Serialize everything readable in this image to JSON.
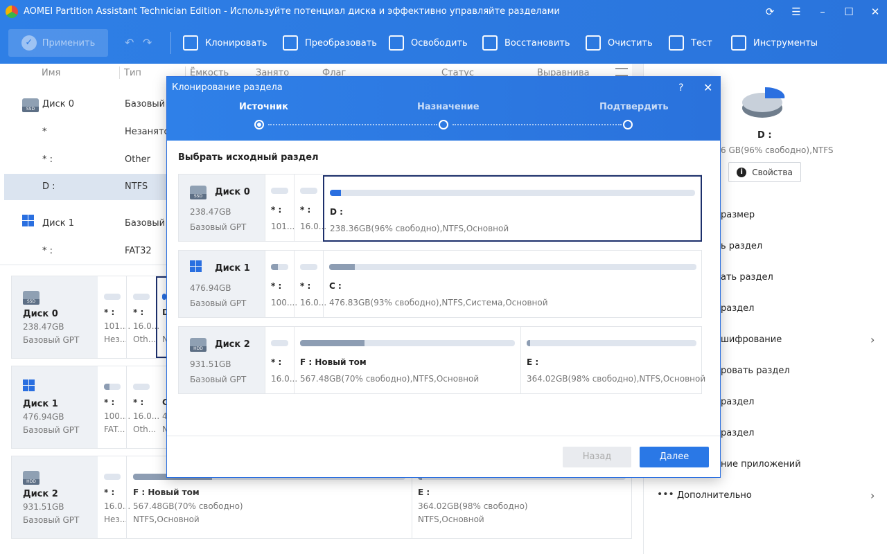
{
  "app": {
    "title": "AOMEI Partition Assistant Technician Edition - Используйте потенциал диска и эффективно управляйте разделами"
  },
  "toolbar": {
    "apply": "Применить",
    "items": [
      "Клонировать",
      "Преобразовать",
      "Освободить",
      "Восстановить",
      "Очистить",
      "Тест",
      "Инструменты"
    ]
  },
  "table": {
    "headers": [
      "Имя",
      "Тип",
      "Ёмкость",
      "Занято",
      "Флаг",
      "Статус",
      "Выравнива"
    ],
    "rows": [
      {
        "name": "Диск 0",
        "type": "Базовый G"
      },
      {
        "name": "*",
        "type": "Незанято"
      },
      {
        "name": "* :",
        "type": "Other"
      },
      {
        "name": "D :",
        "type": "NTFS"
      },
      {
        "name": "Диск 1",
        "type": "Базовый G"
      },
      {
        "name": "* :",
        "type": "FAT32"
      }
    ]
  },
  "diskmap": [
    {
      "name": "Диск 0",
      "size": "238.47GB",
      "type": "Базовый GPT",
      "parts": [
        {
          "n": "* :",
          "s": "101....",
          "f": "Нез..."
        },
        {
          "n": "* :",
          "s": "16.0...",
          "f": "Oth..."
        },
        {
          "n": "D",
          "s": "",
          "f": "N"
        }
      ]
    },
    {
      "name": "Диск 1",
      "size": "476.94GB",
      "type": "Базовый GPT",
      "parts": [
        {
          "n": "* :",
          "s": "100....",
          "f": "FAT..."
        },
        {
          "n": "* :",
          "s": "16.0...",
          "f": "Oth..."
        },
        {
          "n": "C",
          "s": "4",
          "f": "N"
        }
      ]
    },
    {
      "name": "Диск 2",
      "size": "931.51GB",
      "type": "Базовый GPT",
      "parts": [
        {
          "n": "* :",
          "s": "16.0...",
          "f": "Нез..."
        },
        {
          "n": "F : Новый том",
          "s": "567.48GB(70% свободно)",
          "f": "NTFS,Основной"
        },
        {
          "n": "E :",
          "s": "364.02GB(98% свободно)",
          "f": "NTFS,Основной"
        }
      ]
    }
  ],
  "right_panel": {
    "drive": "D :",
    "info": "6 GB(96% свободно),NTFS",
    "properties": "Свойства",
    "items": [
      "размер",
      "ь раздел",
      "ать раздел",
      "раздел",
      "шифрование",
      "ровать раздел",
      "раздел",
      "раздел",
      "ние приложений",
      "Дополнительно"
    ]
  },
  "modal": {
    "title": "Клонирование раздела",
    "steps": [
      "Источник",
      "Назначение",
      "Подтвердить"
    ],
    "subtitle": "Выбрать исходный раздел",
    "disks": [
      {
        "name": "Диск 0",
        "size": "238.47GB",
        "type": "Базовый GPT",
        "parts": [
          {
            "n": "* :",
            "d": "101...",
            "fill": 0
          },
          {
            "n": "* :",
            "d": "16.0...",
            "fill": 0
          },
          {
            "n": "D :",
            "d": "238.36GB(96% свободно),NTFS,Основной",
            "fill": 4
          }
        ]
      },
      {
        "name": "Диск 1",
        "size": "476.94GB",
        "type": "Базовый GPT",
        "parts": [
          {
            "n": "* :",
            "d": "100....",
            "fill": 40
          },
          {
            "n": "* :",
            "d": "16.0...",
            "fill": 0
          },
          {
            "n": "C :",
            "d": "476.83GB(93% свободно),NTFS,Система,Основной",
            "fill": 7
          }
        ]
      },
      {
        "name": "Диск 2",
        "size": "931.51GB",
        "type": "Базовый GPT",
        "parts": [
          {
            "n": "* :",
            "d": "16.0...",
            "fill": 0
          },
          {
            "n": "F : Новый том",
            "d": "567.48GB(70% свободно),NTFS,Основной",
            "fill": 30
          },
          {
            "n": "E :",
            "d": "364.02GB(98% свободно),NTFS,Основной",
            "fill": 2
          }
        ]
      }
    ],
    "back": "Назад",
    "next": "Далее"
  },
  "colors": {
    "accent": "#2a6fe0",
    "selected": "#1c2f6b"
  }
}
